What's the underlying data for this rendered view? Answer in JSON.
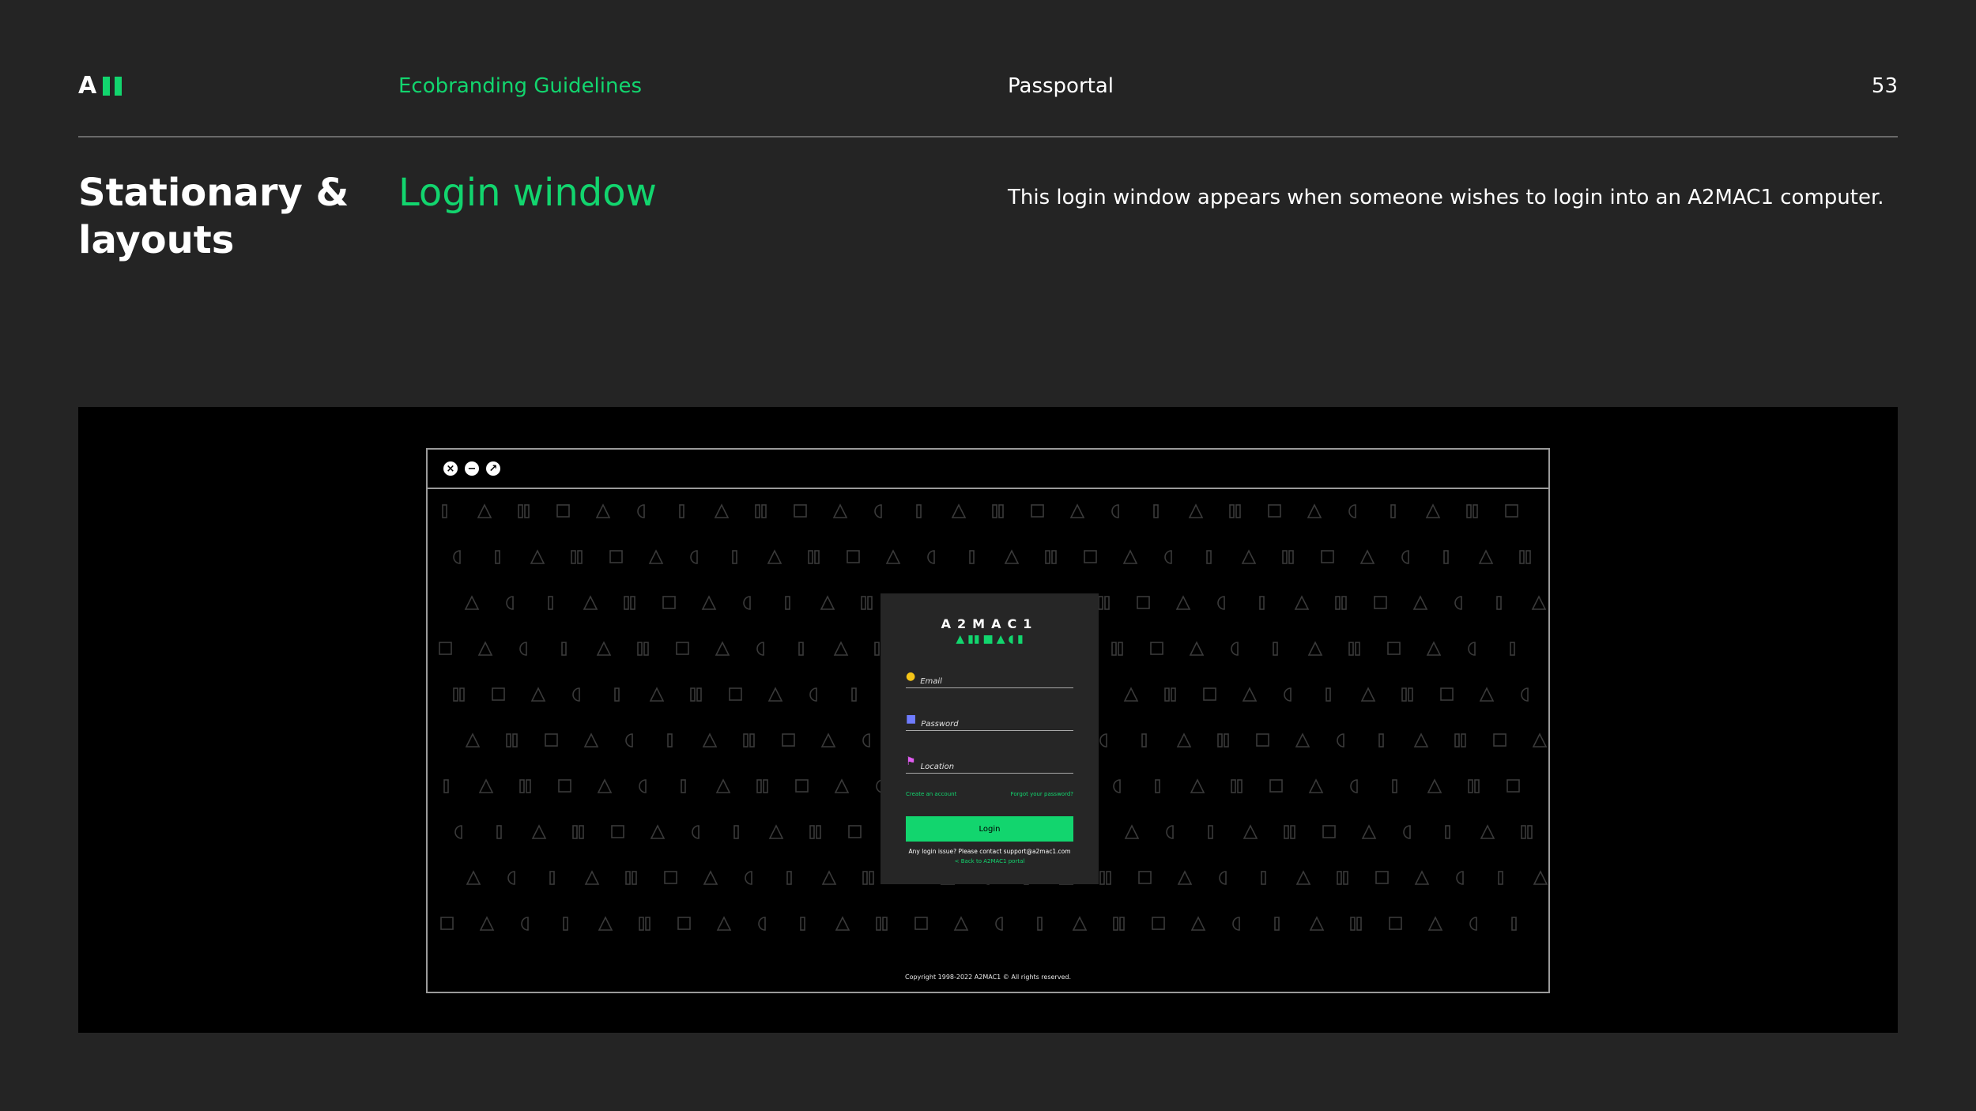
{
  "header": {
    "logo_letter": "A",
    "brand": "Ecobranding Guidelines",
    "section": "Passportal",
    "page_number": "53"
  },
  "title": {
    "left": "Stationary & layouts",
    "main": "Login window"
  },
  "description": "This login window appears when someone wishes to login into an A2MAC1 computer.",
  "window": {
    "controls": [
      "close-icon",
      "minimize-icon",
      "maximize-icon"
    ],
    "copyright": "Copyright 1998-2022 A2MAC1 © All rights reserved."
  },
  "login": {
    "logo_text": "A2MAC1",
    "fields": [
      {
        "label": "Email",
        "icon": "person-icon",
        "color": "#f5c518"
      },
      {
        "label": "Password",
        "icon": "lock-icon",
        "color": "#6f7cff"
      },
      {
        "label": "Location",
        "icon": "flag-icon",
        "color": "#e05cf0"
      }
    ],
    "create_account": "Create an account",
    "forgot_password": "Forgot your password?",
    "login_button": "Login",
    "issue_text": "Any login issue? Please contact support@a2mac1.com",
    "back_link": "< Back to A2MAC1 portal"
  },
  "colors": {
    "accent": "#12d56e",
    "background": "#242424",
    "showcase": "#000000"
  }
}
